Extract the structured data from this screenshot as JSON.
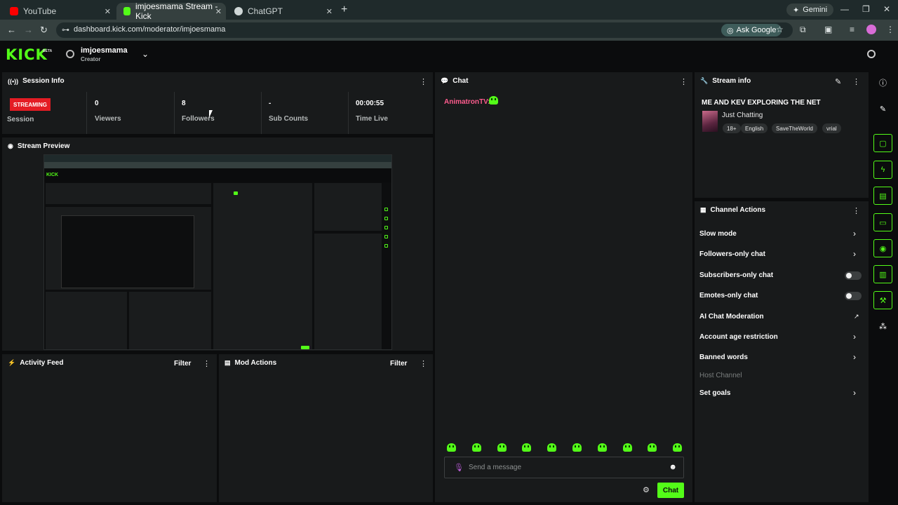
{
  "browser": {
    "tabs": [
      {
        "title": "YouTube",
        "favicon_color": "#ff0000"
      },
      {
        "title": "imjoesmama Stream - Kick",
        "favicon_color": "#53fc18"
      },
      {
        "title": "ChatGPT",
        "favicon_color": "#cfd6d6"
      }
    ],
    "gemini_label": "Gemini",
    "url": "dashboard.kick.com/moderator/imjoesmama",
    "ask_google_label": "Ask Google"
  },
  "header": {
    "logo": "KICK",
    "logo_badge": "BETA",
    "channel_name": "imjoesmama",
    "channel_role": "Creator"
  },
  "session": {
    "title": "Session Info",
    "badge": "STREAMING",
    "session_label": "Session",
    "stats": [
      {
        "value": "0",
        "label": "Viewers"
      },
      {
        "value": "8",
        "label": "Followers"
      },
      {
        "value": "-",
        "label": "Sub Counts"
      },
      {
        "value": "00:00:55",
        "label": "Time Live"
      }
    ]
  },
  "preview": {
    "title": "Stream Preview"
  },
  "activity": {
    "title": "Activity Feed",
    "filter": "Filter"
  },
  "mod_actions": {
    "title": "Mod Actions",
    "filter": "Filter"
  },
  "chat": {
    "title": "Chat",
    "message_user": "AnimatronTV:",
    "placeholder": "Send a message",
    "send_label": "Chat",
    "emote_count": 10
  },
  "stream_info": {
    "title": "Stream info",
    "stream_title": "ME AND KEV EXPLORING THE NET",
    "category": "Just Chatting",
    "tags": [
      "18+",
      "English",
      "SaveTheWorld",
      "vrial"
    ]
  },
  "channel_actions": {
    "title": "Channel Actions",
    "items": [
      {
        "label": "Slow mode",
        "control": "chevron"
      },
      {
        "label": "Followers-only chat",
        "control": "chevron"
      },
      {
        "label": "Subscribers-only chat",
        "control": "toggle"
      },
      {
        "label": "Emotes-only chat",
        "control": "toggle"
      },
      {
        "label": "AI Chat Moderation",
        "control": "external"
      },
      {
        "label": "Account age restriction",
        "control": "chevron"
      },
      {
        "label": "Banned words",
        "control": "chevron"
      },
      {
        "label": "Host Channel",
        "control": "none"
      },
      {
        "label": "Set goals",
        "control": "chevron"
      }
    ]
  },
  "colors": {
    "accent": "#53fc18",
    "streaming_red": "#e41c24",
    "chat_user": "#fe5c8e"
  }
}
